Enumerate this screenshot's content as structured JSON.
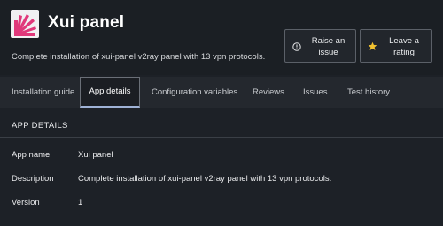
{
  "header": {
    "title": "Xui panel",
    "description": "Complete installation of xui-panel v2ray panel with 13 vpn protocols.",
    "raise_issue_label": "Raise an\nissue",
    "leave_rating_label": "Leave a\nrating",
    "logo_color": "#e0387a",
    "star_color": "#f2c230"
  },
  "tabs": [
    {
      "label": "Installation guide"
    },
    {
      "label": "App details",
      "active": true
    },
    {
      "label": "Configuration variables"
    },
    {
      "label": "Reviews"
    },
    {
      "label": "Issues"
    },
    {
      "label": "Test history"
    }
  ],
  "section": {
    "title": "APP DETAILS",
    "rows": [
      {
        "label": "App name",
        "value": "Xui panel"
      },
      {
        "label": "Description",
        "value": "Complete installation of xui-panel v2ray panel with 13 vpn protocols."
      },
      {
        "label": "Version",
        "value": "1"
      }
    ]
  }
}
